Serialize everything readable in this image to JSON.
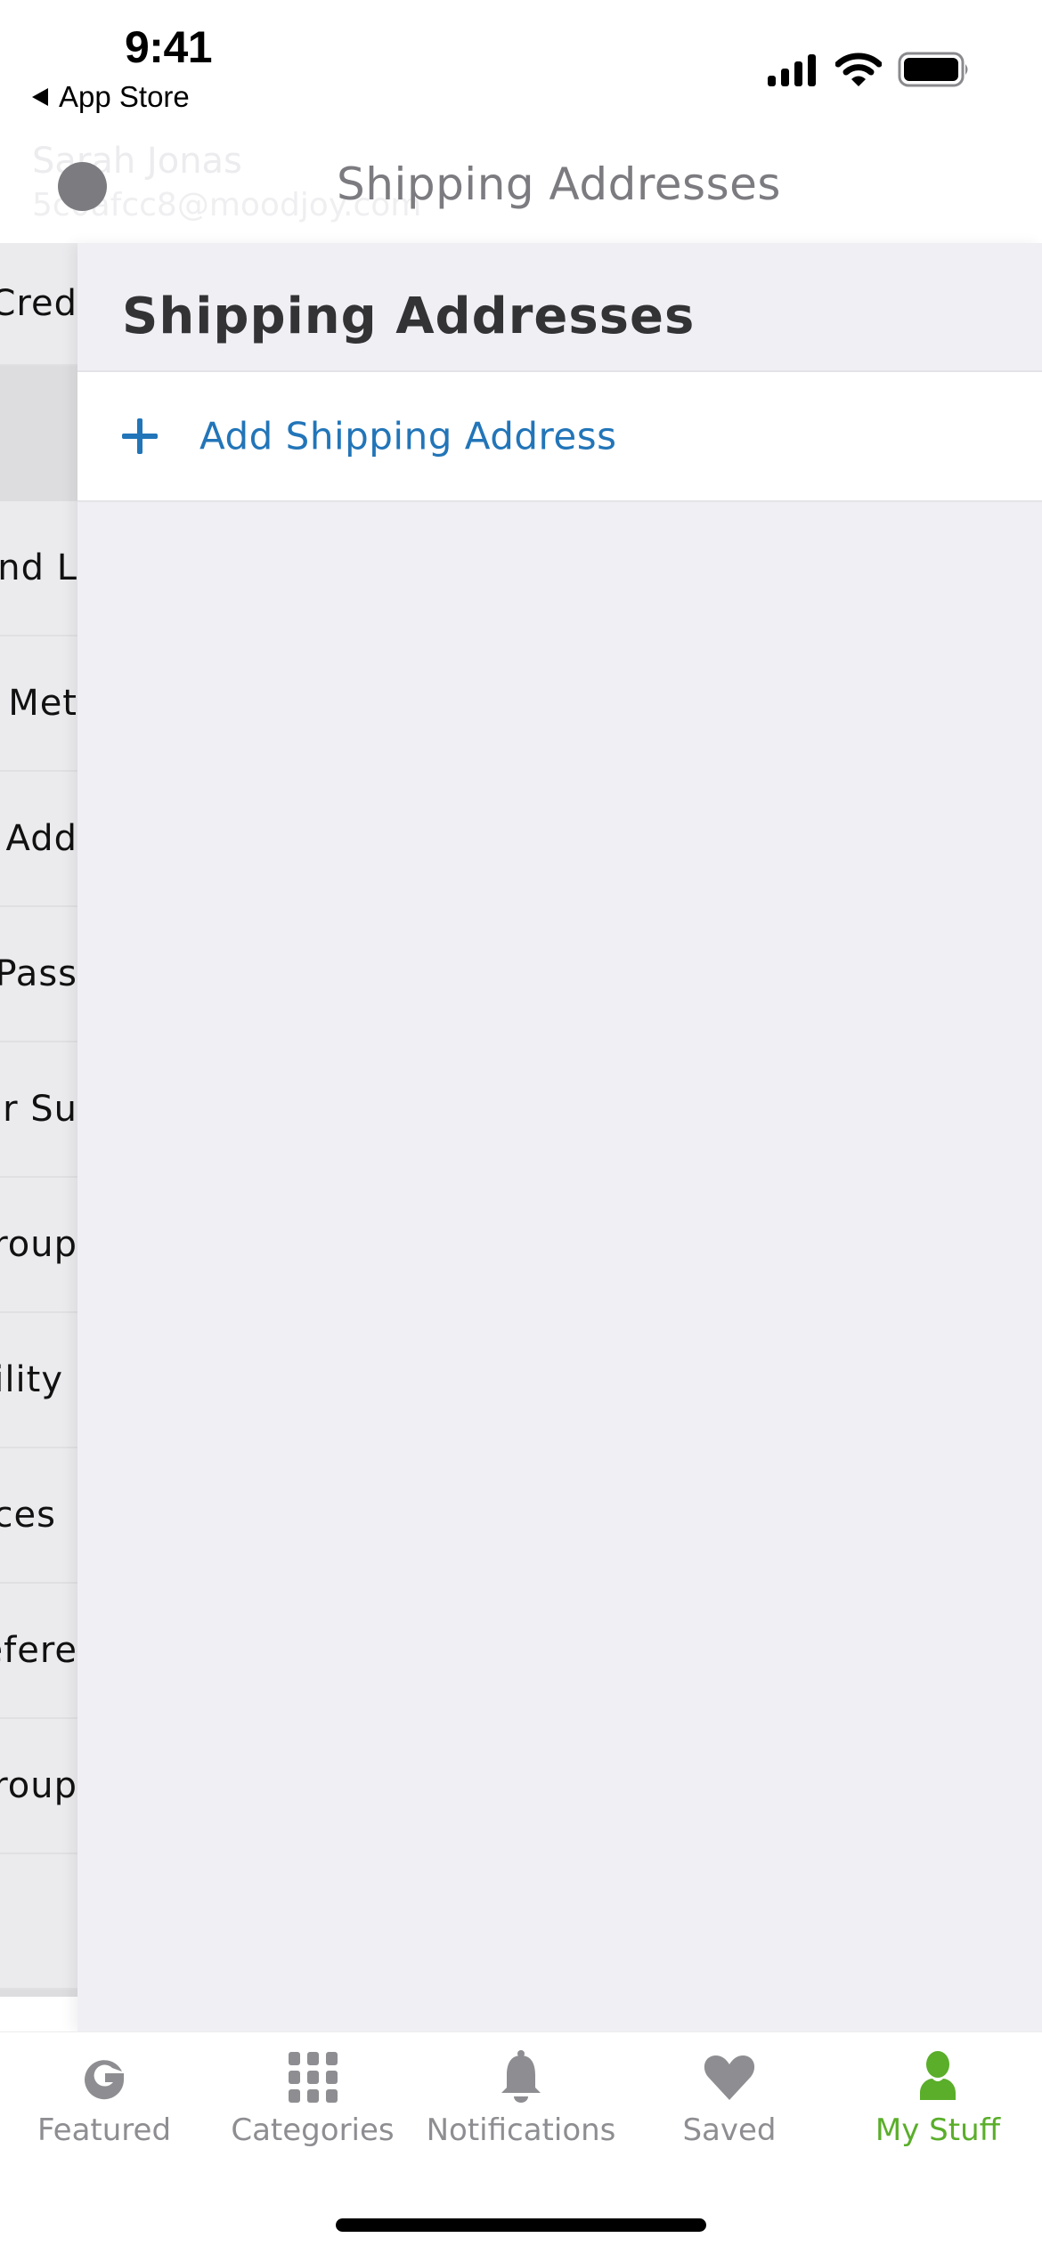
{
  "status_bar": {
    "time": "9:41",
    "back_label": "App Store",
    "icons": [
      "cellular-signal-icon",
      "wifi-icon",
      "battery-icon"
    ]
  },
  "nav_header": {
    "title": "Shipping Addresses",
    "faded_profile_name": "Sarah Jonas",
    "faded_profile_email": "5c0afcc8@moodjoy.com"
  },
  "underlying_list": {
    "rows": [
      {
        "visible_text": "Cred"
      },
      {
        "visible_text": ""
      },
      {
        "visible_text": "und L"
      },
      {
        "visible_text": "Met"
      },
      {
        "visible_text": "Add"
      },
      {
        "visible_text": "Pass"
      },
      {
        "visible_text": "r Su"
      },
      {
        "visible_text": "roup"
      },
      {
        "visible_text": "ility"
      },
      {
        "visible_text": "ces"
      },
      {
        "visible_text": "efere"
      },
      {
        "visible_text": "roup"
      },
      {
        "visible_text": ""
      }
    ]
  },
  "page": {
    "title": "Shipping Addresses",
    "add_action": {
      "label": "Add Shipping Address",
      "icon": "plus-icon"
    }
  },
  "tab_bar": {
    "active_color": "#5aae2a",
    "inactive_color": "#8e8e92",
    "tabs": [
      {
        "label": "Featured",
        "icon": "g-logo-icon",
        "active": false
      },
      {
        "label": "Categories",
        "icon": "grid-icon",
        "active": false
      },
      {
        "label": "Notifications",
        "icon": "bell-icon",
        "active": false
      },
      {
        "label": "Saved",
        "icon": "heart-icon",
        "active": false
      },
      {
        "label": "My Stuff",
        "icon": "person-icon",
        "active": true
      }
    ]
  }
}
